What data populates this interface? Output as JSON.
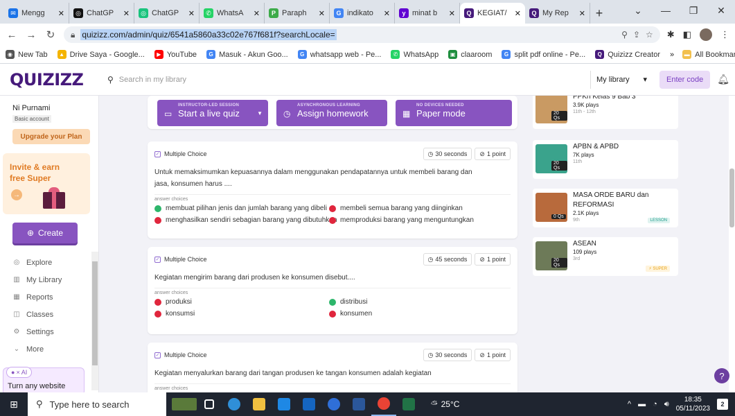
{
  "browser": {
    "tabs": [
      {
        "label": "Mengg",
        "favicon_color": "#1a73e8",
        "glyph": "✉"
      },
      {
        "label": "ChatGP",
        "favicon_color": "#111111",
        "glyph": "◎"
      },
      {
        "label": "ChatGP",
        "favicon_color": "#19c37d",
        "glyph": "◎"
      },
      {
        "label": "WhatsA",
        "favicon_color": "#25d366",
        "glyph": "✆"
      },
      {
        "label": "Paraph",
        "favicon_color": "#3dab4a",
        "glyph": "P"
      },
      {
        "label": "indikato",
        "favicon_color": "#4285f4",
        "glyph": "G"
      },
      {
        "label": "minat b",
        "favicon_color": "#6001d2",
        "glyph": "y"
      },
      {
        "label": "KEGIAT/",
        "favicon_color": "#461a7b",
        "glyph": "Q",
        "active": true
      },
      {
        "label": "My Rep",
        "favicon_color": "#461a7b",
        "glyph": "Q"
      }
    ],
    "url": "quizizz.com/admin/quiz/6541a5860a33c02e767f681f?searchLocale=",
    "bookmarks": [
      {
        "label": "New Tab",
        "color": "#555555",
        "glyph": "◉"
      },
      {
        "label": "Drive Saya - Google...",
        "color": "#f4b400",
        "glyph": "▲"
      },
      {
        "label": "YouTube",
        "color": "#ff0000",
        "glyph": "▶"
      },
      {
        "label": "Masuk - Akun Goo...",
        "color": "#4285f4",
        "glyph": "G"
      },
      {
        "label": "whatsapp web - Pe...",
        "color": "#4285f4",
        "glyph": "G"
      },
      {
        "label": "WhatsApp",
        "color": "#25d366",
        "glyph": "✆"
      },
      {
        "label": "claaroom",
        "color": "#1e8e3e",
        "glyph": "▣"
      },
      {
        "label": "split pdf online - Pe...",
        "color": "#4285f4",
        "glyph": "G"
      },
      {
        "label": "Quizizz Creator",
        "color": "#461a7b",
        "glyph": "Q"
      }
    ],
    "more_bookmarks": "»",
    "all_bookmarks": "All Bookmarks"
  },
  "app": {
    "logo": "QUIZIZZ",
    "search_placeholder": "Search in my library",
    "library_select": "My library",
    "enter_code": "Enter code"
  },
  "sidebar": {
    "user_name": "Ni Purnami",
    "account_type": "Basic account",
    "upgrade": "Upgrade your Plan",
    "invite": "Invite & earn free Super",
    "create": "Create",
    "nav": [
      {
        "label": "Explore",
        "icon": "compass-icon",
        "glyph": "◎"
      },
      {
        "label": "My Library",
        "icon": "library-icon",
        "glyph": "▥"
      },
      {
        "label": "Reports",
        "icon": "reports-icon",
        "glyph": "▦"
      },
      {
        "label": "Classes",
        "icon": "classes-icon",
        "glyph": "◫"
      },
      {
        "label": "Settings",
        "icon": "gear-icon",
        "glyph": "⚙"
      },
      {
        "label": "More",
        "icon": "chevron-down-icon",
        "glyph": "⌄"
      }
    ],
    "ai_badge": "× AI",
    "ai_text": "Turn any website"
  },
  "actions": {
    "live": {
      "sub": "INSTRUCTOR-LED SESSION",
      "label": "Start a live quiz"
    },
    "homework": {
      "sub": "ASYNCHRONOUS LEARNING",
      "label": "Assign homework"
    },
    "paper": {
      "sub": "NO DEVICES NEEDED",
      "label": "Paper mode"
    }
  },
  "questions": [
    {
      "type": "Multiple Choice",
      "time": "30 seconds",
      "points": "1 point",
      "text": "Untuk memaksimumkan kepuasannya dalam menggunakan pendapatannya untuk membeli barang dan jasa, konsumen harus ....",
      "choices_label": "answer choices",
      "options": [
        {
          "text": "membuat pilihan jenis dan jumlah barang yang dibeli",
          "correct": true
        },
        {
          "text": "membeli semua barang yang diinginkan",
          "correct": false
        },
        {
          "text": "menghasilkan sendiri sebagian barang yang dibutuhkan",
          "correct": false
        },
        {
          "text": "memproduksi barang yang menguntungkan",
          "correct": false
        }
      ]
    },
    {
      "type": "Multiple Choice",
      "time": "45 seconds",
      "points": "1 point",
      "text": "Kegiatan mengirim barang dari produsen ke konsumen disebut....",
      "choices_label": "answer choices",
      "options": [
        {
          "text": "produksi",
          "correct": false
        },
        {
          "text": "distribusi",
          "correct": true
        },
        {
          "text": "konsumsi",
          "correct": false
        },
        {
          "text": "konsumen",
          "correct": false
        }
      ]
    },
    {
      "type": "Multiple Choice",
      "time": "30 seconds",
      "points": "1 point",
      "text": "Kegiatan menyalurkan barang dari tangan produsen ke tangan konsumen adalah kegiatan",
      "choices_label": "answer choices",
      "options": []
    }
  ],
  "recommendations": [
    {
      "title": "PPKn Kelas 9 Bab 3",
      "plays": "3.9K plays",
      "grade": "11th - 12th",
      "qs": "20 Qs",
      "thumb": "#c99a63",
      "tag": ""
    },
    {
      "title": "APBN & APBD",
      "plays": "7K plays",
      "grade": "11th",
      "qs": "20 Qs",
      "thumb": "#3aa38c",
      "tag": ""
    },
    {
      "title": "MASA ORDE BARU dan REFORMASI",
      "plays": "2.1K plays",
      "grade": "9th",
      "qs": "0 Qs",
      "thumb": "#b86a3c",
      "tag": "LESSON"
    },
    {
      "title": "ASEAN",
      "plays": "109 plays",
      "grade": "3rd",
      "qs": "20 Qs",
      "thumb": "#6d7a58",
      "tag": "⚡ SUPER"
    }
  ],
  "help": "?",
  "taskbar": {
    "search": "Type here to search",
    "weather": "25°C",
    "time": "18:35",
    "date": "05/11/2023",
    "notifications": "2",
    "apps": [
      {
        "name": "landscape-app",
        "color": "#5a7a3a"
      },
      {
        "name": "task-view",
        "color": "#ffffff"
      },
      {
        "name": "edge-app",
        "color": "#2f8fd8"
      },
      {
        "name": "file-explorer-app",
        "color": "#f0c040"
      },
      {
        "name": "store-app",
        "color": "#1e88e5"
      },
      {
        "name": "mail-app",
        "color": "#1565c0"
      },
      {
        "name": "media-app",
        "color": "#2f6fd8"
      },
      {
        "name": "word-app",
        "color": "#2b579a"
      },
      {
        "name": "chrome-app",
        "color": "#ea4335"
      },
      {
        "name": "excel-app",
        "color": "#217346"
      }
    ]
  }
}
